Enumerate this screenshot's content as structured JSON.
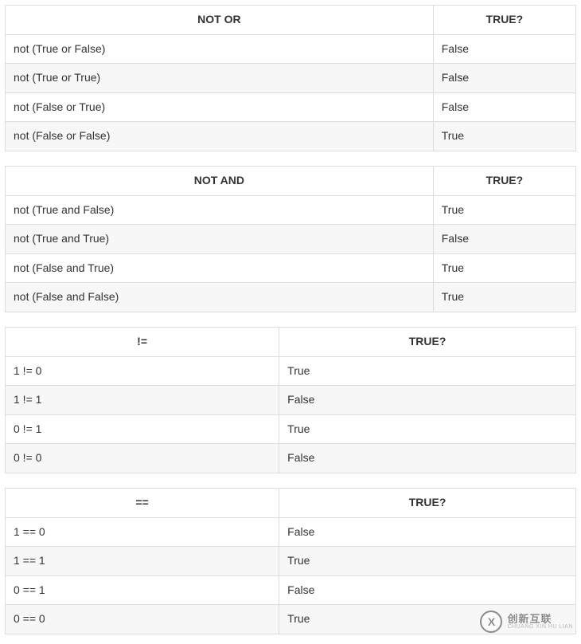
{
  "tables": [
    {
      "layout": "t12",
      "headers": [
        "NOT OR",
        "TRUE?"
      ],
      "rows": [
        [
          "not (True or False)",
          "False"
        ],
        [
          "not (True or True)",
          "False"
        ],
        [
          "not (False or True)",
          "False"
        ],
        [
          "not (False or False)",
          "True"
        ]
      ]
    },
    {
      "layout": "t12",
      "headers": [
        "NOT AND",
        "TRUE?"
      ],
      "rows": [
        [
          "not (True and False)",
          "True"
        ],
        [
          "not (True and True)",
          "False"
        ],
        [
          "not (False and True)",
          "True"
        ],
        [
          "not (False and False)",
          "True"
        ]
      ]
    },
    {
      "layout": "t34",
      "headers": [
        "!=",
        "TRUE?"
      ],
      "rows": [
        [
          "1 != 0",
          "True"
        ],
        [
          "1 != 1",
          "False"
        ],
        [
          "0 != 1",
          "True"
        ],
        [
          "0 != 0",
          "False"
        ]
      ]
    },
    {
      "layout": "t34",
      "headers": [
        "==",
        "TRUE?"
      ],
      "rows": [
        [
          "1 == 0",
          "False"
        ],
        [
          "1 == 1",
          "True"
        ],
        [
          "0 == 1",
          "False"
        ],
        [
          "0 == 0",
          "True"
        ]
      ]
    }
  ],
  "watermark": {
    "logo_letter": "X",
    "zh": "创新互联",
    "py": "CHUANG XIN HU LIAN"
  }
}
